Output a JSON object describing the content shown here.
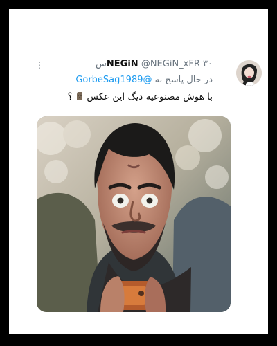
{
  "tweet": {
    "display_name": "NEGiN",
    "handle": "@NEGiN_xFR",
    "time": "۳۰س",
    "reply_prefix": "در حال پاسخ به",
    "reply_to": "@GorbeSag1989",
    "text": "با هوش مصنوعیه دیگ این عکس",
    "emoji": "moai",
    "question_mark": "؟"
  },
  "icons": {
    "more": "more-options-icon",
    "moai": "moai-emoji-icon"
  }
}
